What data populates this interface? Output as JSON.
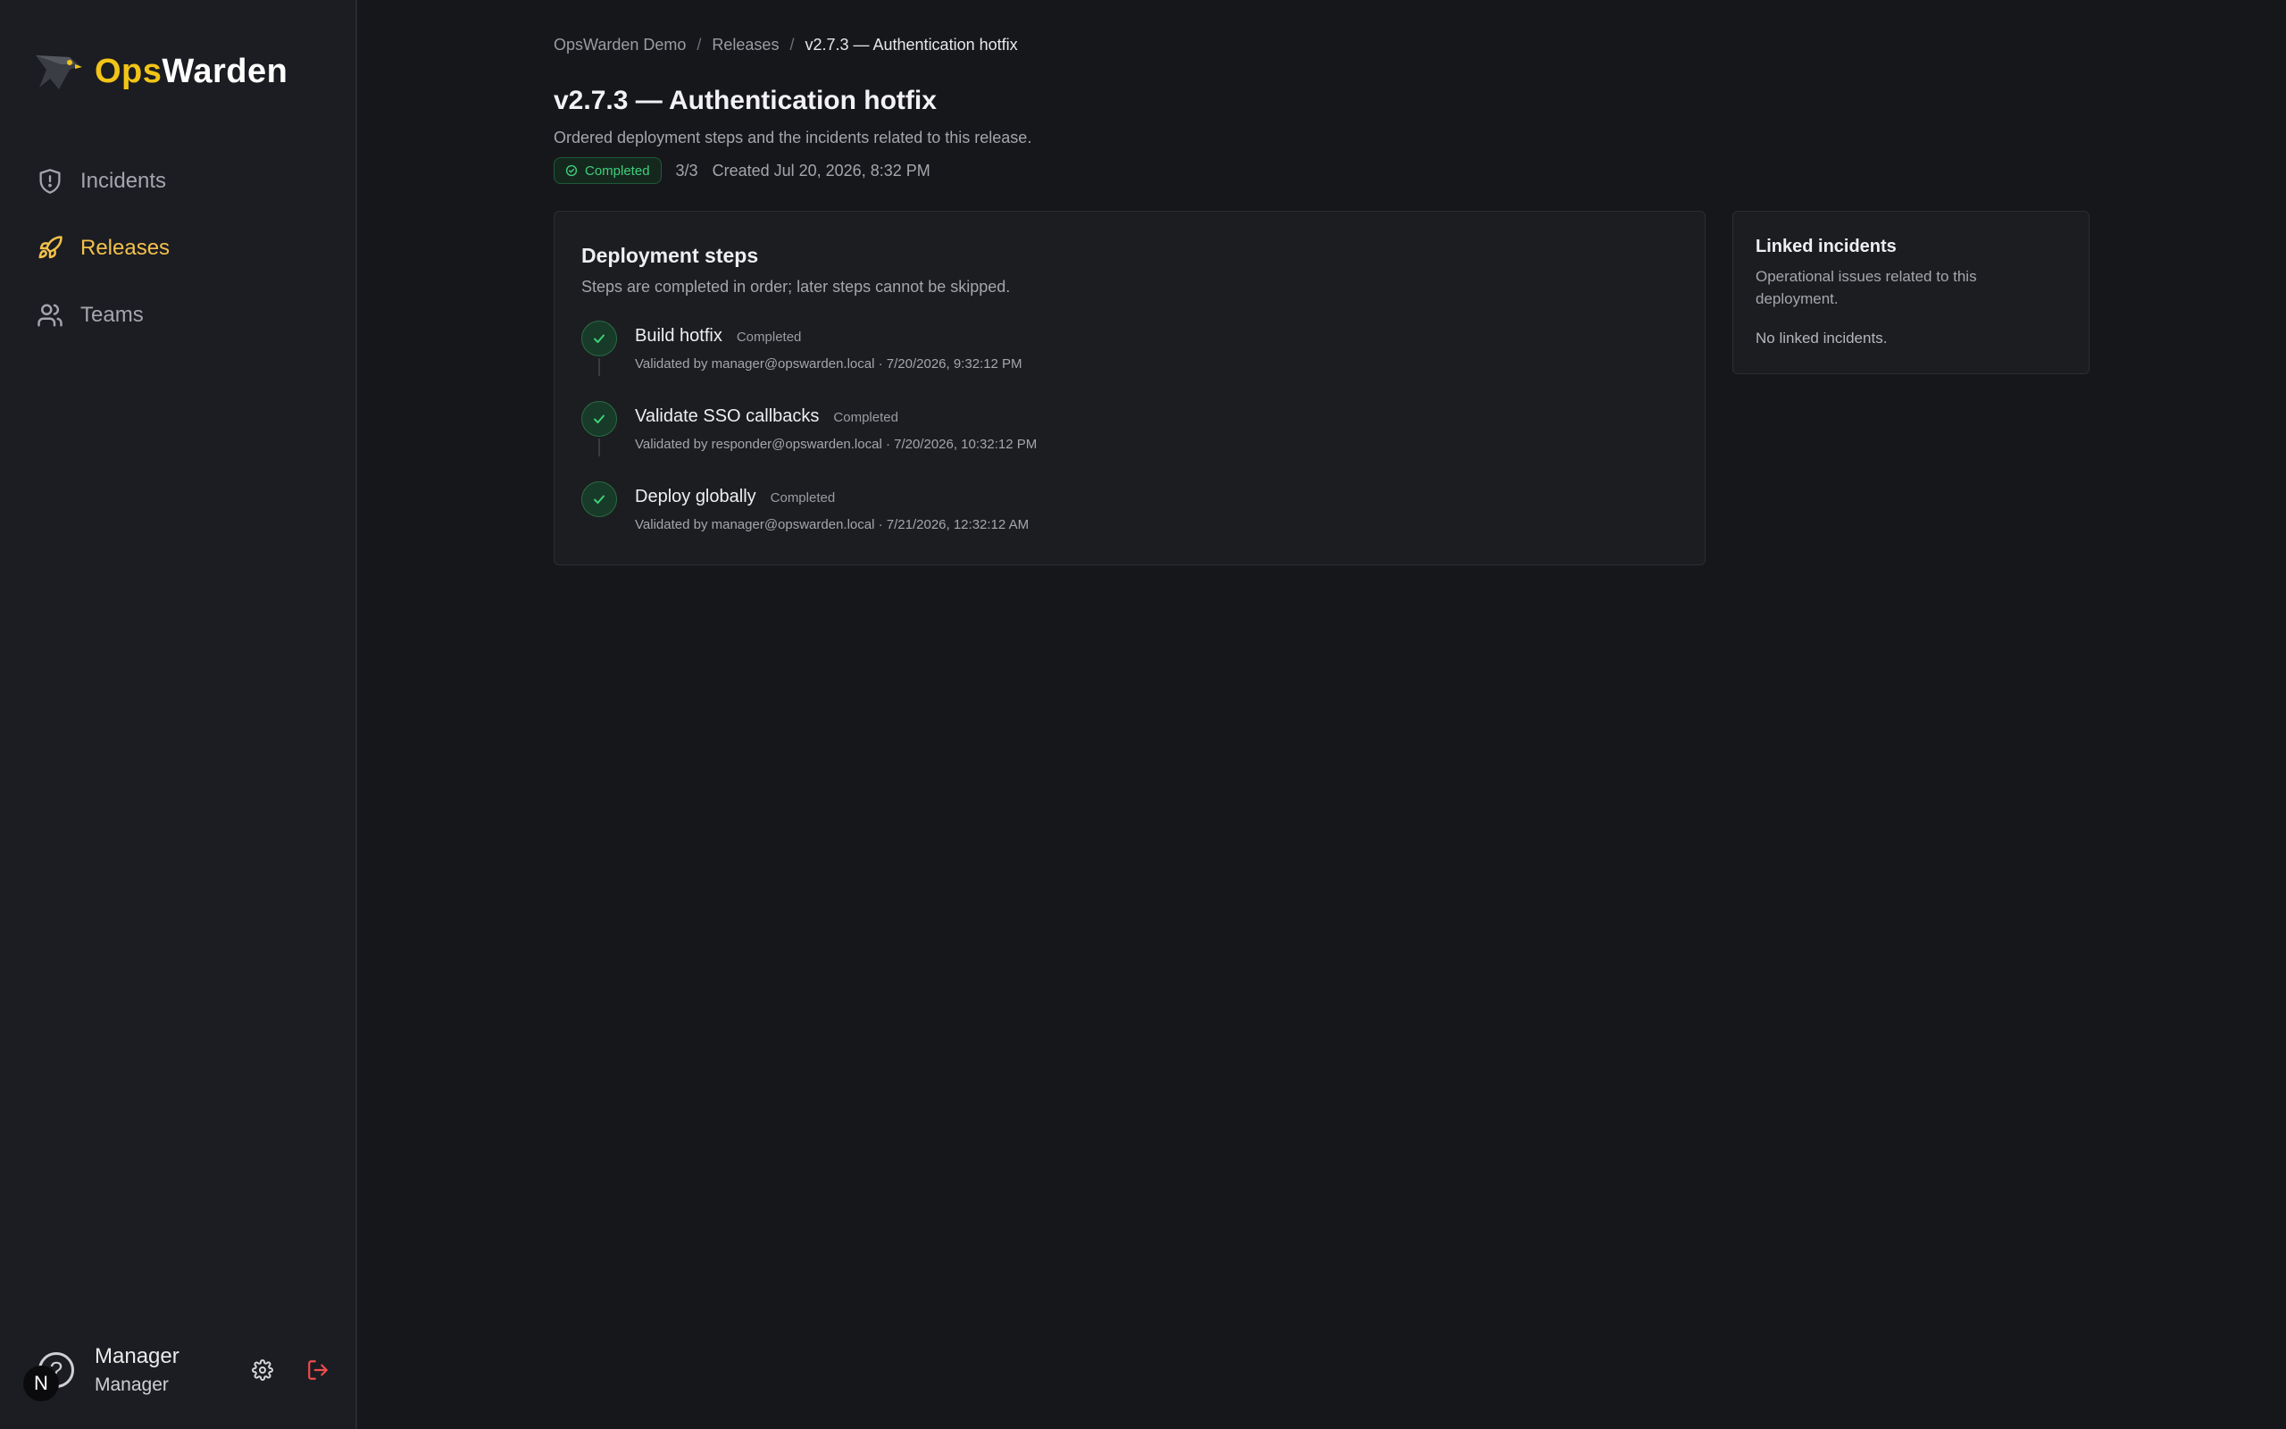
{
  "app": {
    "brand_part1": "Ops",
    "brand_part2": "Warden",
    "accent_color": "#f2c417"
  },
  "sidebar": {
    "items": [
      {
        "label": "Incidents",
        "icon": "shield-icon",
        "active": false
      },
      {
        "label": "Releases",
        "icon": "rocket-icon",
        "active": true
      },
      {
        "label": "Teams",
        "icon": "users-icon",
        "active": false
      }
    ],
    "user": {
      "avatar_initial": "N",
      "name": "Manager",
      "role": "Manager"
    }
  },
  "breadcrumb": {
    "items": [
      "OpsWarden Demo",
      "Releases",
      "v2.7.3 — Authentication hotfix"
    ],
    "separator": "/"
  },
  "page": {
    "title": "v2.7.3 — Authentication hotfix",
    "subtitle": "Ordered deployment steps and the incidents related to this release.",
    "status": "Completed",
    "progress": "3/3",
    "created": "Created Jul 20, 2026, 8:32 PM"
  },
  "steps_card": {
    "title": "Deployment steps",
    "description": "Steps are completed in order; later steps cannot be skipped.",
    "steps": [
      {
        "title": "Build hotfix",
        "status": "Completed",
        "meta": "Validated by manager@opswarden.local · 7/20/2026, 9:32:12 PM"
      },
      {
        "title": "Validate SSO callbacks",
        "status": "Completed",
        "meta": "Validated by responder@opswarden.local · 7/20/2026, 10:32:12 PM"
      },
      {
        "title": "Deploy globally",
        "status": "Completed",
        "meta": "Validated by manager@opswarden.local · 7/21/2026, 12:32:12 AM"
      }
    ]
  },
  "linked_card": {
    "title": "Linked incidents",
    "description": "Operational issues related to this deployment.",
    "empty": "No linked incidents."
  }
}
